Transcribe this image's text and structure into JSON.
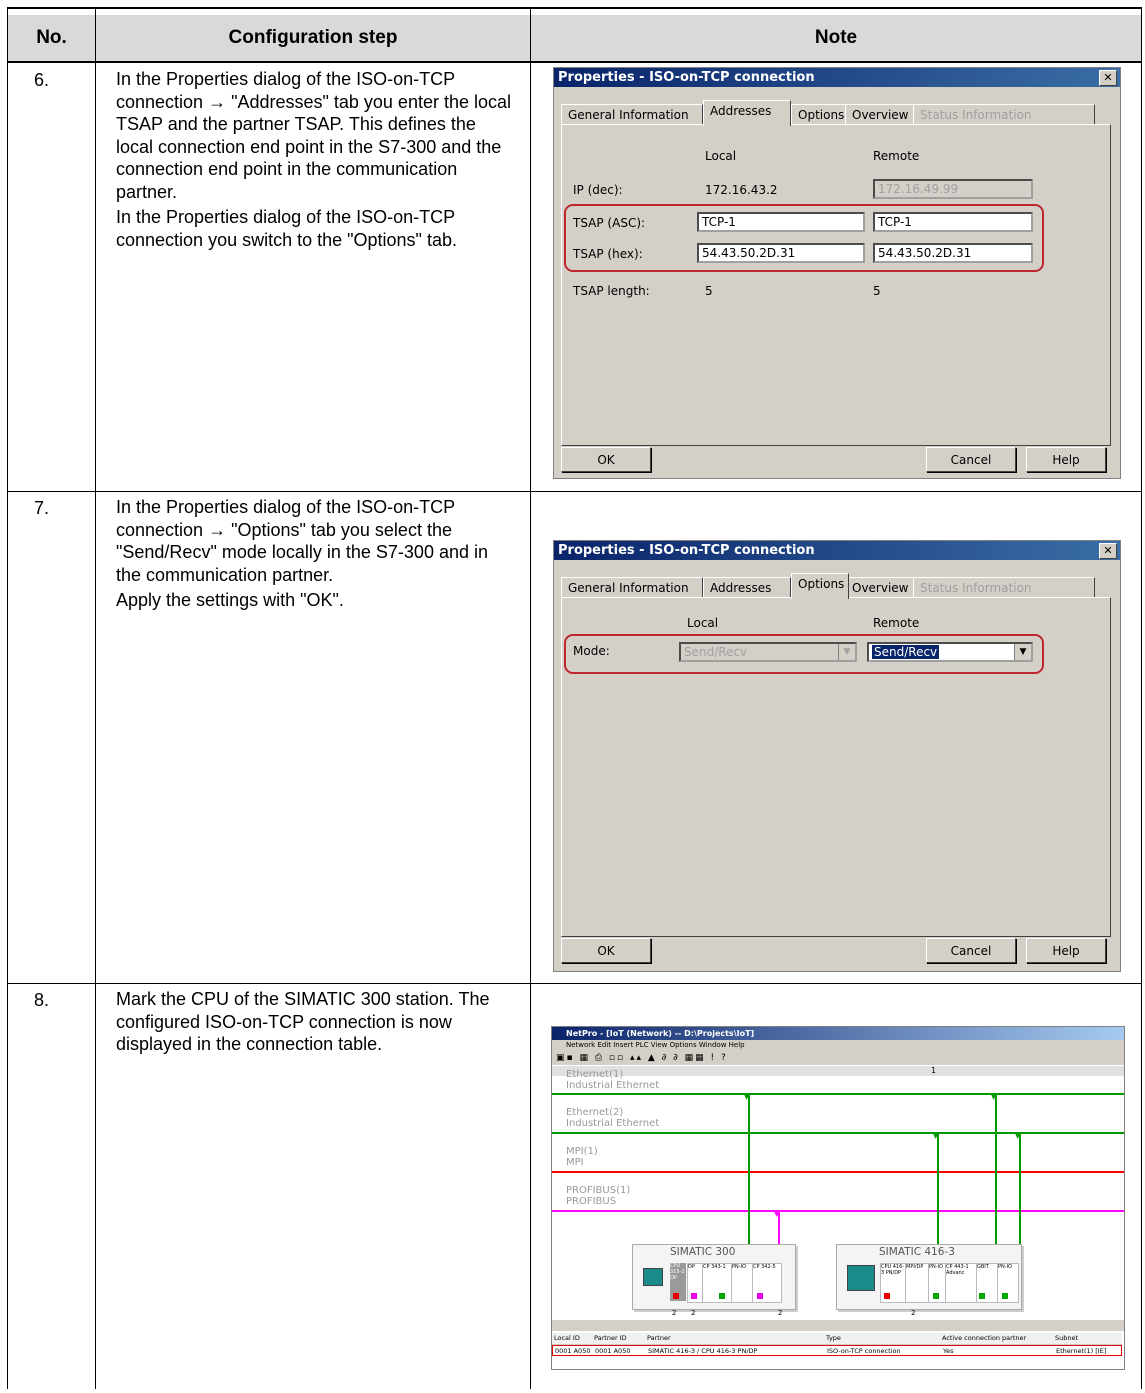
{
  "table": {
    "headers": [
      "No.",
      "Configuration step",
      "Note"
    ],
    "rows": [
      {
        "no": "6.",
        "step": [
          "In the Properties dialog of the ISO-on-TCP connection → \"Addresses\" tab you enter the local TSAP and the partner TSAP. This defines the local connection end point in the S7-300 and the connection end point in the communication partner.",
          "In the Properties dialog of the ISO-on-TCP connection you switch to the \"Options\" tab."
        ]
      },
      {
        "no": "7.",
        "step": [
          "In the Properties dialog of the ISO-on-TCP connection → \"Options\" tab you select the \"Send/Recv\" mode locally in the S7-300 and in the communication partner.",
          "Apply the settings with \"OK\"."
        ]
      },
      {
        "no": "8.",
        "step": [
          "Mark the CPU of the SIMATIC 300 station. The configured ISO-on-TCP connection is now displayed in the connection table."
        ]
      }
    ]
  },
  "dialog_addresses": {
    "title": "Properties - ISO-on-TCP connection",
    "tabs": [
      "General Information",
      "Addresses",
      "Options",
      "Overview",
      "Status Information"
    ],
    "active_tab": "Addresses",
    "col_local": "Local",
    "col_remote": "Remote",
    "ip_label": "IP (dec):",
    "ip_local": "172.16.43.2",
    "ip_remote": "172.16.49.99",
    "tsap_asc_label": "TSAP (ASC):",
    "tsap_asc_local": "TCP-1",
    "tsap_asc_remote": "TCP-1",
    "tsap_hex_label": "TSAP (hex):",
    "tsap_hex_local": "54.43.50.2D.31",
    "tsap_hex_remote": "54.43.50.2D.31",
    "tsap_len_label": "TSAP length:",
    "tsap_len_local": "5",
    "tsap_len_remote": "5",
    "ok": "OK",
    "cancel": "Cancel",
    "help": "Help"
  },
  "dialog_options": {
    "title": "Properties - ISO-on-TCP connection",
    "tabs": [
      "General Information",
      "Addresses",
      "Options",
      "Overview",
      "Status Information"
    ],
    "active_tab": "Options",
    "col_local": "Local",
    "col_remote": "Remote",
    "mode_label": "Mode:",
    "mode_local": "Send/Recv",
    "mode_remote": "Send/Recv",
    "ok": "OK",
    "cancel": "Cancel",
    "help": "Help"
  },
  "netpro": {
    "title": "NetPro - [IoT (Network) -- D:\\Projects\\IoT]",
    "menu": "Network  Edit  Insert  PLC  View  Options  Window  Help",
    "networks": [
      {
        "name": "Ethernet(1)",
        "type": "Industrial Ethernet",
        "color": "#009900"
      },
      {
        "name": "Ethernet(2)",
        "type": "Industrial Ethernet",
        "color": "#009900"
      },
      {
        "name": "MPI(1)",
        "type": "MPI",
        "color": "#ff0000"
      },
      {
        "name": "PROFIBUS(1)",
        "type": "PROFIBUS",
        "color": "#ff00ff"
      }
    ],
    "ruler_number": "1",
    "station1": {
      "name": "SIMATIC 300",
      "modules": [
        "CPU 315-2 DP",
        "DP",
        "CP 343-1",
        "PN-IO",
        "CP 342-5"
      ],
      "numbers": [
        "2",
        "2",
        "2"
      ]
    },
    "station2": {
      "name": "SIMATIC 416-3",
      "modules": [
        "CPU 416-3 PN/DP",
        "MPI/DP",
        "PN-IO",
        "CP 443-1 Advanc",
        "GBIT",
        "PN-IO"
      ],
      "numbers": [
        "2"
      ]
    },
    "conn_table": {
      "headers": [
        "Local ID",
        "Partner ID",
        "Partner",
        "Type",
        "Active connection partner",
        "Subnet"
      ],
      "row": [
        "0001 A050",
        "0001 A050",
        "SIMATIC 416-3 / CPU 416-3 PN/DP",
        "ISO-on-TCP connection",
        "Yes",
        "Ethernet(1) [IE]"
      ]
    }
  }
}
